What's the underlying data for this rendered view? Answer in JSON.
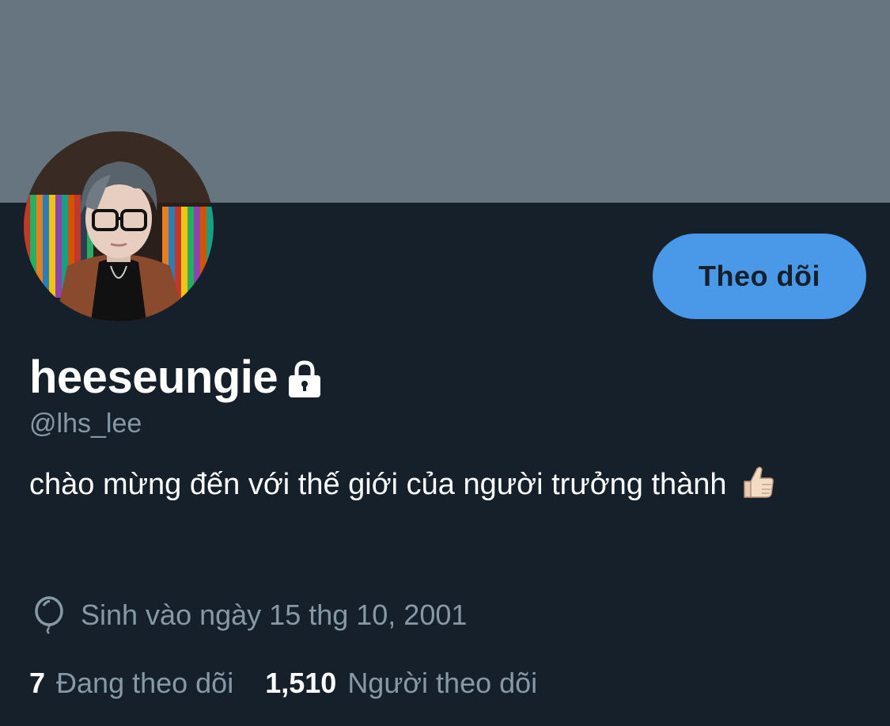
{
  "profile": {
    "display_name": "heeseungie",
    "handle": "@lhs_lee",
    "bio_text": "chào mừng đến với thế giới của người trưởng thành",
    "bio_emoji": "thumbs-up-light-skin",
    "protected": true,
    "birth_date": "Sinh vào ngày 15 thg 10, 2001",
    "follow_button_label": "Theo dõi",
    "following": {
      "count": "7",
      "label": "Đang theo dõi"
    },
    "followers": {
      "count": "1,510",
      "label": "Người theo dõi"
    }
  },
  "icons": {
    "lock": "lock-icon",
    "birthday": "balloon-icon"
  },
  "colors": {
    "background": "#15202b",
    "banner": "#66757f",
    "accent": "#4a99e9",
    "secondary_text": "#8899a6",
    "primary_text": "#ffffff"
  }
}
